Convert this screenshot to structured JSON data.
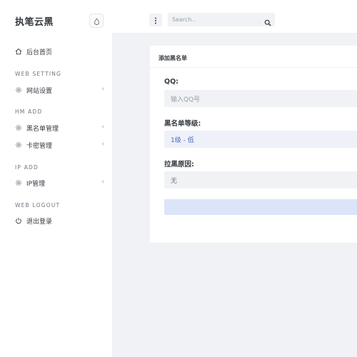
{
  "app": {
    "brand": "执笔云黑"
  },
  "sidebar": {
    "items": [
      {
        "label": "后台首页",
        "icon": "home-icon"
      },
      {
        "label": "网站设置",
        "icon": "gear-icon"
      },
      {
        "label": "黑名单管理",
        "icon": "gear-icon"
      },
      {
        "label": "卡密管理",
        "icon": "gear-icon"
      },
      {
        "label": "IP管理",
        "icon": "gear-icon"
      },
      {
        "label": "退出登录",
        "icon": "power-icon"
      }
    ],
    "sections": [
      "WEB SETTING",
      "HM ADD",
      "IP ADD",
      "WEB LOGOUT"
    ],
    "chevron": "‹"
  },
  "topbar": {
    "search_placeholder": "Search.."
  },
  "form": {
    "title": "添加黑名单",
    "qq_label": "QQ:",
    "qq_placeholder": "输入QQ号",
    "level_label": "黑名单等级:",
    "level_value": "1级 - 低",
    "reason_label": "拉黑原因:",
    "reason_value": "无",
    "submit_label": ""
  },
  "colors": {
    "accent": "#4a69bd",
    "background": "#f0f2f5",
    "button": "#dbe4f8"
  }
}
